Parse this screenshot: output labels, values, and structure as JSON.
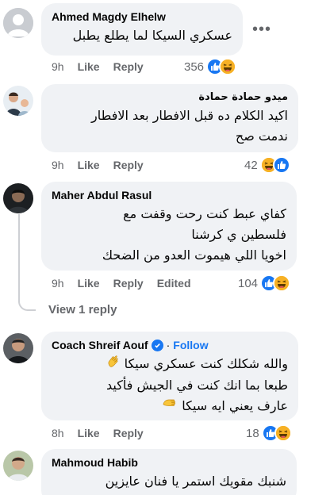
{
  "more_options_label": "•••",
  "comments": [
    {
      "author": "Ahmed Magdy Elhelw",
      "lines": [
        "عسكري السيكا لما يطلع يطبل"
      ],
      "time": "9h",
      "like_label": "Like",
      "reply_label": "Reply",
      "reaction_count": "356",
      "reactions": [
        "like",
        "haha"
      ]
    },
    {
      "author": "ميدو حمادة حمادة",
      "lines": [
        "اكيد الكلام ده قبل الافطار بعد الافطار",
        "ندمت صح"
      ],
      "time": "9h",
      "like_label": "Like",
      "reply_label": "Reply",
      "reaction_count": "42",
      "reactions": [
        "haha",
        "like"
      ]
    },
    {
      "author": "Maher Abdul Rasul",
      "lines": [
        "كفاي عبط كنت رحت وقفت مع",
        "فلسطين ي كرشنا",
        "اخويا اللي هيموت العدو من الضحك"
      ],
      "time": "9h",
      "like_label": "Like",
      "reply_label": "Reply",
      "edited_label": "Edited",
      "reaction_count": "104",
      "reactions": [
        "like",
        "haha"
      ]
    },
    {
      "author": "Coach Shreif Aouf",
      "dot": "·",
      "follow_label": "Follow",
      "lines": [
        "والله شكلك كنت عسكري سيكا",
        "طبعا بما انك كنت في الجيش فأكيد",
        "عارف يعني ايه سيكا"
      ],
      "time": "8h",
      "like_label": "Like",
      "reply_label": "Reply",
      "reaction_count": "18",
      "reactions": [
        "like",
        "haha"
      ]
    },
    {
      "author": "Mahmoud Habib",
      "lines": [
        "شنبك مقويك استمر يا فنان عايزين"
      ]
    }
  ],
  "view_replies_label": "View 1 reply",
  "colors": {
    "bubble": "#f0f2f5",
    "meta": "#65676b",
    "like_blue": "#1877f2",
    "haha_yellow": "#f7b125",
    "thread_line": "#ced0d4"
  },
  "icons": [
    "like-reaction-icon",
    "haha-reaction-icon",
    "verified-badge-icon",
    "clapping-hand-icon",
    "ok-hand-icon"
  ]
}
